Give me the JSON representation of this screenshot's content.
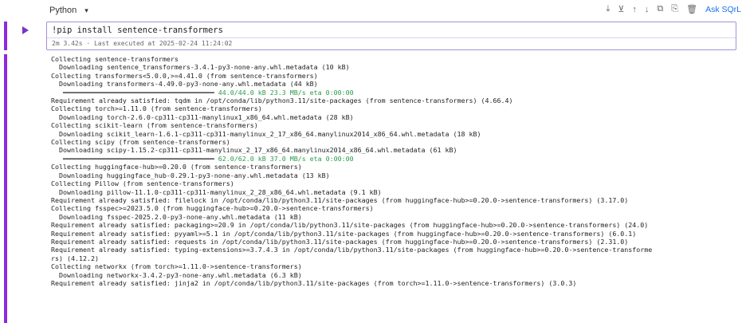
{
  "toolbar": {
    "language": "Python",
    "ask_label": "Ask SQrL",
    "icons": [
      "download-icon",
      "save-icon",
      "move-up-icon",
      "move-down-icon",
      "copy-icon",
      "paste-icon",
      "delete-icon"
    ]
  },
  "cell": {
    "code": "!pip install sentence-transformers",
    "exec_info": "2m 3.42s · Last executed at 2025-02-24 11:24:02"
  },
  "output": {
    "lines": [
      "Collecting sentence-transformers",
      "  Downloading sentence_transformers-3.4.1-py3-none-any.whl.metadata (10 kB)",
      "Collecting transformers<5.0.0,>=4.41.0 (from sentence-transformers)",
      "  Downloading transformers-4.49.0-py3-none-any.whl.metadata (44 kB)",
      "",
      "Requirement already satisfied: tqdm in /opt/conda/lib/python3.11/site-packages (from sentence-transformers) (4.66.4)",
      "Collecting torch>=1.11.0 (from sentence-transformers)",
      "  Downloading torch-2.6.0-cp311-cp311-manylinux1_x86_64.whl.metadata (28 kB)",
      "Collecting scikit-learn (from sentence-transformers)",
      "  Downloading scikit_learn-1.6.1-cp311-cp311-manylinux_2_17_x86_64.manylinux2014_x86_64.whl.metadata (18 kB)",
      "Collecting scipy (from sentence-transformers)",
      "  Downloading scipy-1.15.2-cp311-cp311-manylinux_2_17_x86_64.manylinux2014_x86_64.whl.metadata (61 kB)",
      "",
      "Collecting huggingface-hub>=0.20.0 (from sentence-transformers)",
      "  Downloading huggingface_hub-0.29.1-py3-none-any.whl.metadata (13 kB)",
      "Collecting Pillow (from sentence-transformers)",
      "  Downloading pillow-11.1.0-cp311-cp311-manylinux_2_28_x86_64.whl.metadata (9.1 kB)",
      "Requirement already satisfied: filelock in /opt/conda/lib/python3.11/site-packages (from huggingface-hub>=0.20.0->sentence-transformers) (3.17.0)",
      "Collecting fsspec>=2023.5.0 (from huggingface-hub>=0.20.0->sentence-transformers)",
      "  Downloading fsspec-2025.2.0-py3-none-any.whl.metadata (11 kB)",
      "Requirement already satisfied: packaging>=20.9 in /opt/conda/lib/python3.11/site-packages (from huggingface-hub>=0.20.0->sentence-transformers) (24.0)",
      "Requirement already satisfied: pyyaml>=5.1 in /opt/conda/lib/python3.11/site-packages (from huggingface-hub>=0.20.0->sentence-transformers) (6.0.1)",
      "Requirement already satisfied: requests in /opt/conda/lib/python3.11/site-packages (from huggingface-hub>=0.20.0->sentence-transformers) (2.31.0)",
      "Requirement already satisfied: typing-extensions>=3.7.4.3 in /opt/conda/lib/python3.11/site-packages (from huggingface-hub>=0.20.0->sentence-transforme",
      "rs) (4.12.2)",
      "Collecting networkx (from torch>=1.11.0->sentence-transformers)",
      "  Downloading networkx-3.4.2-py3-none-any.whl.metadata (6.3 kB)",
      "Requirement already satisfied: jinja2 in /opt/conda/lib/python3.11/site-packages (from torch>=1.11.0->sentence-transformers) (3.0.3)"
    ],
    "progress": [
      {
        "after_line": 3,
        "text": "44.0/44.0 kB 23.3 MB/s eta 0:00:00",
        "fraction": 1.0
      },
      {
        "after_line": 11,
        "text": "62.0/62.0 kB 37.0 MB/s eta 0:00:00",
        "fraction": 1.0
      }
    ]
  }
}
